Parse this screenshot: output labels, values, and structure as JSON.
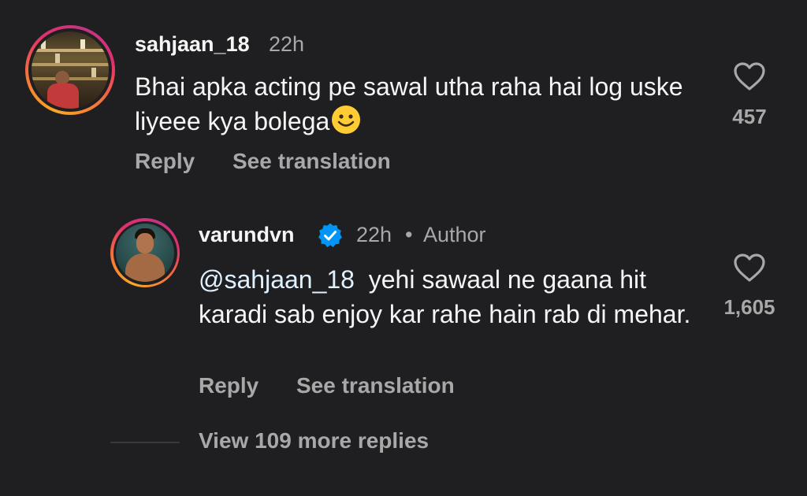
{
  "comments": [
    {
      "username": "sahjaan_18",
      "time": "22h",
      "text": "Bhai apka acting pe sawal utha raha hai log uske liyeee kya bolega",
      "emoji": "smiling-face-emoji",
      "likes": "457",
      "reply_label": "Reply",
      "translate_label": "See translation"
    },
    {
      "username": "varundvn",
      "verified": true,
      "time": "22h",
      "separator": "•",
      "author_label": "Author",
      "mention": "@sahjaan_18",
      "text": "yehi sawaal ne gaana hit karadi sab enjoy kar rahe hain rab di mehar.",
      "likes": "1,605",
      "reply_label": "Reply",
      "translate_label": "See translation"
    }
  ],
  "view_more_label": "View 109 more replies",
  "colors": {
    "background": "#1f1f21",
    "text_primary": "#f5f5f5",
    "text_secondary": "#a8a8a8",
    "verified_blue": "#0095f6",
    "emoji_yellow": "#ffcc33"
  }
}
